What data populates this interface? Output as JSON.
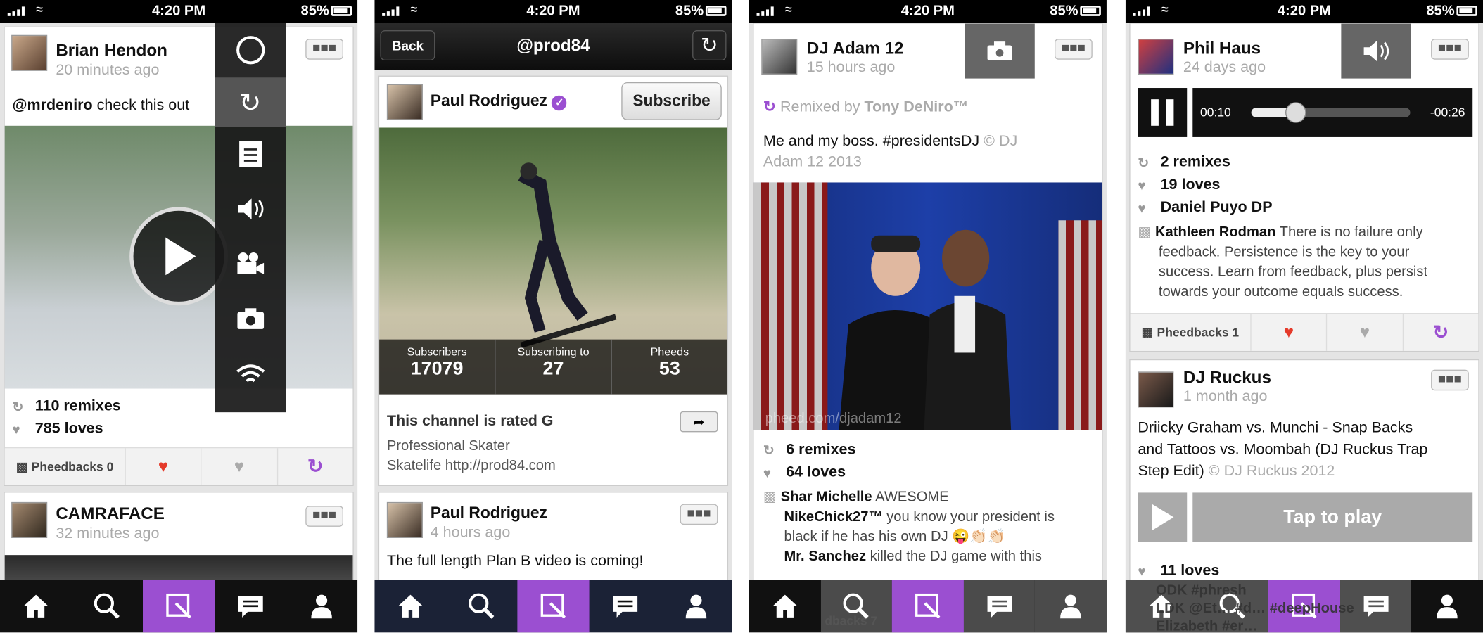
{
  "status": {
    "time": "4:20 PM",
    "battery": "85%"
  },
  "colors": {
    "accent": "#9b4fd1",
    "love": "#e53a2a"
  },
  "tabbar_icons": [
    "home-icon",
    "search-icon",
    "compose-icon",
    "comments-icon",
    "profile-icon"
  ],
  "screen1": {
    "post1": {
      "name": "Brian Hendon",
      "time": "20 minutes ago",
      "mention": "@mrdeniro",
      "text": " check this out",
      "remixes": "110 remixes",
      "loves": "785 loves",
      "pheedbacks": "Pheedbacks 0"
    },
    "post2": {
      "name": "CAMRAFACE",
      "time": "32 minutes ago"
    },
    "side_menu": [
      "circle-icon",
      "remix-icon",
      "document-icon",
      "audio-icon",
      "video-icon",
      "camera-icon",
      "broadcast-icon"
    ]
  },
  "screen2": {
    "header": {
      "back": "Back",
      "title": "@prod84"
    },
    "profile": {
      "name": "Paul Rodriguez",
      "subscribe": "Subscribe"
    },
    "stats": [
      {
        "label": "Subscribers",
        "value": "17079"
      },
      {
        "label": "Subscribing to",
        "value": "27"
      },
      {
        "label": "Pheeds",
        "value": "53"
      }
    ],
    "rating": "This channel is rated G",
    "bio1": "Professional Skater",
    "bio2": "Skatelife http://prod84.com",
    "post": {
      "name": "Paul Rodriguez",
      "time": "4 hours ago",
      "text": "The full length Plan B video is coming!"
    }
  },
  "screen3": {
    "post": {
      "name": "DJ Adam 12",
      "time": "15 hours ago",
      "remixed_prefix": "Remixed by ",
      "remixed_by": "Tony DeNiro™",
      "text": "Me and my boss. #presidentsDJ",
      "copy1": " © DJ",
      "copy2": "Adam 12 2013",
      "watermark": "pheed.com/djadam12",
      "remixes": "6 remixes",
      "loves": "64 loves"
    },
    "comments": [
      {
        "user": "Shar Michelle",
        "text": " AWESOME"
      },
      {
        "user": "NikeChick27™",
        "text": " you know your president is"
      },
      {
        "user": "",
        "text": "black if he has his own DJ 😜👏🏻👏🏻"
      },
      {
        "user": "Mr. Sanchez",
        "text": " killed the DJ game with this"
      }
    ],
    "pheedbacks_partial": "dbacks 7"
  },
  "screen4": {
    "post1": {
      "name": "Phil Haus",
      "time": "24 days ago",
      "elapsed": "00:10",
      "remaining": "-00:26",
      "progress": 0.28,
      "remixes": "2 remixes",
      "loves": "19 loves",
      "hater": "Daniel Puyo DP",
      "commenter": "Kathleen Rodman",
      "comment1": " There is no failure only",
      "comment2": "feedback.  Persistence is the key to your",
      "comment3": "success. Learn from feedback, plus persist",
      "comment4": "towards your outcome equals success.",
      "pheedbacks": "Pheedbacks 1"
    },
    "post2": {
      "name": "DJ Ruckus",
      "time": "1 month ago",
      "text1": "Driicky Graham vs. Munchi - Snap Backs",
      "text2": "and Tattoos vs. Moombah (DJ Ruckus Trap",
      "text3": "Step Edit)",
      "copy": " © DJ Ruckus 2012",
      "tap": "Tap to play",
      "loves": "11 loves",
      "l1": "ODK #phresh",
      "l2": "LDK @Et… #d… #deepHouse",
      "l3": "Elizabeth #er…"
    }
  }
}
